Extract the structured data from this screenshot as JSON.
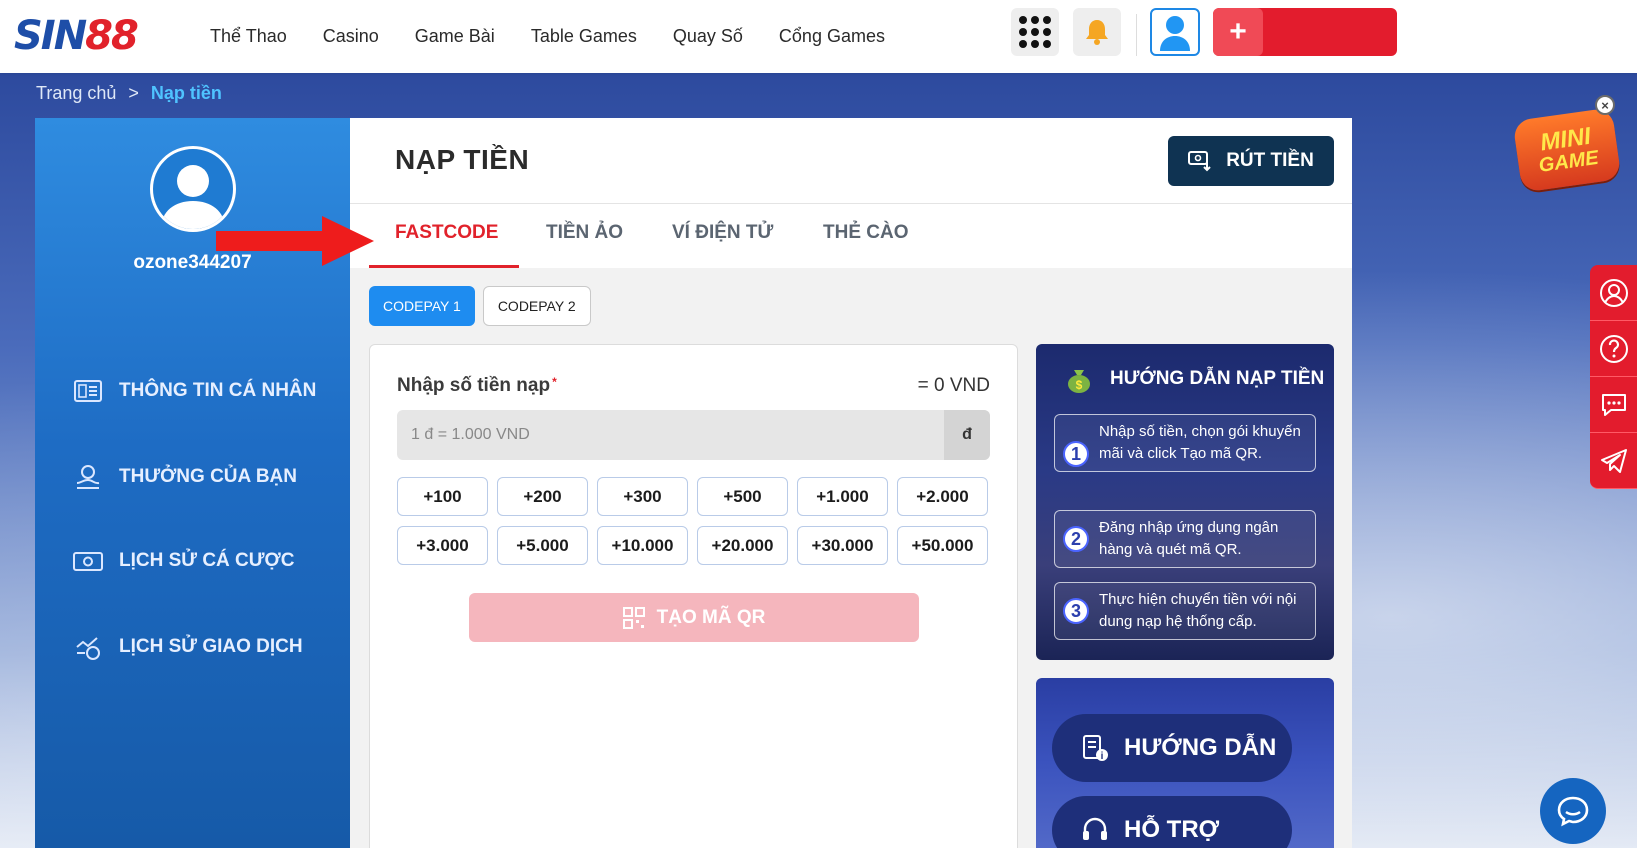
{
  "header": {
    "logo_part1": "SIN",
    "logo_part2": "88",
    "nav": [
      "Thể Thao",
      "Casino",
      "Game Bài",
      "Table Games",
      "Quay Số",
      "Cổng Games"
    ],
    "deposit_plus": "+"
  },
  "breadcrumb": {
    "home": "Trang chủ",
    "separator": ">",
    "current": "Nạp tiền"
  },
  "sidebar": {
    "username": "ozone344207",
    "items": [
      {
        "label": "THÔNG TIN CÁ NHÂN",
        "icon": "profile-card-icon"
      },
      {
        "label": "THƯỞNG CỦA BẠN",
        "icon": "reward-hand-icon"
      },
      {
        "label": "LỊCH SỬ CÁ CƯỢC",
        "icon": "money-bill-icon"
      },
      {
        "label": "LỊCH SỬ GIAO DỊCH",
        "icon": "transaction-chart-icon"
      }
    ]
  },
  "main": {
    "title": "NẠP TIỀN",
    "withdraw_label": "RÚT TIỀN",
    "tabs": [
      "FASTCODE",
      "TIỀN ẢO",
      "VÍ ĐIỆN TỬ",
      "THẺ CÀO"
    ],
    "active_tab": "FASTCODE",
    "sub_tabs": [
      "CODEPAY 1",
      "CODEPAY 2"
    ],
    "active_sub_tab": "CODEPAY 1"
  },
  "form": {
    "amount_label": "Nhập số tiền nạp",
    "required_mark": "*",
    "conversion": "= 0 VND",
    "input_placeholder": "1 đ = 1.000 VND",
    "input_value": "",
    "unit": "đ",
    "chips": [
      "+100",
      "+200",
      "+300",
      "+500",
      "+1.000",
      "+2.000",
      "+3.000",
      "+5.000",
      "+10.000",
      "+20.000",
      "+30.000",
      "+50.000"
    ],
    "submit_label": "TẠO MÃ QR"
  },
  "guide": {
    "title": "HƯỚNG DẪN NẠP TIỀN",
    "steps": [
      {
        "num": "1",
        "text": "Nhập số tiền, chọn gói khuyến mãi và click Tạo mã QR."
      },
      {
        "num": "2",
        "text": "Đăng nhập ứng dụng ngân hàng và quét mã QR."
      },
      {
        "num": "3",
        "text": "Thực hiện chuyển tiền với nội dung nạp hệ thống cấp."
      }
    ]
  },
  "help": {
    "guide_label": "HƯỚNG DẪN",
    "support_label": "HỖ TRỢ"
  },
  "minigame": {
    "line1": "MINI",
    "line2": "GAME",
    "close": "×"
  },
  "colors": {
    "brand_red": "#e31c2d",
    "brand_blue": "#1e8cf0",
    "withdraw_navy": "#0f3352",
    "active_tab": "#e1222b"
  }
}
